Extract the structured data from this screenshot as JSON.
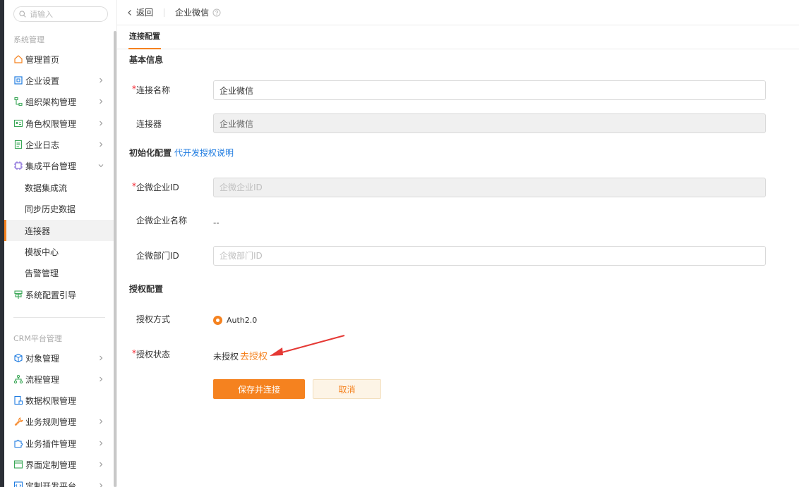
{
  "sidebar": {
    "search_placeholder": "请输入",
    "group1_title": "系统管理",
    "group1_items": [
      {
        "label": "管理首页"
      },
      {
        "label": "企业设置"
      },
      {
        "label": "组织架构管理"
      },
      {
        "label": "角色权限管理"
      },
      {
        "label": "企业日志"
      },
      {
        "label": "集成平台管理"
      }
    ],
    "integration_subitems": [
      {
        "label": "数据集成流"
      },
      {
        "label": "同步历史数据"
      },
      {
        "label": "连接器"
      },
      {
        "label": "模板中心"
      },
      {
        "label": "告警管理"
      }
    ],
    "system_config_label": "系统配置引导",
    "group2_title": "CRM平台管理",
    "group2_items": [
      {
        "label": "对象管理"
      },
      {
        "label": "流程管理"
      },
      {
        "label": "数据权限管理"
      },
      {
        "label": "业务规则管理"
      },
      {
        "label": "业务插件管理"
      },
      {
        "label": "界面定制管理"
      },
      {
        "label": "定制开发平台"
      }
    ]
  },
  "topbar": {
    "back_label": "返回",
    "title": "企业微信"
  },
  "tabs": {
    "active": "连接配置"
  },
  "form": {
    "basic_section": "基本信息",
    "connection_name_label": "连接名称",
    "connection_name_value": "企业微信",
    "connector_label": "连接器",
    "connector_value": "企业微信",
    "init_section": "初始化配置",
    "init_link": "代开发授权说明",
    "corp_id_label": "企微企业ID",
    "corp_id_placeholder": "企微企业ID",
    "corp_name_label": "企微企业名称",
    "corp_name_value": "--",
    "dept_id_label": "企微部门ID",
    "dept_id_placeholder": "企微部门ID",
    "auth_section": "授权配置",
    "auth_method_label": "授权方式",
    "auth_method_value": "Auth2.0",
    "auth_status_label": "授权状态",
    "auth_status_value": "未授权",
    "authorize_link": "去授权",
    "save_button": "保存并连接",
    "cancel_button": "取消"
  },
  "colors": {
    "accent": "#f5821f",
    "link": "#1e7be0",
    "annotation_arrow": "#e53935"
  }
}
